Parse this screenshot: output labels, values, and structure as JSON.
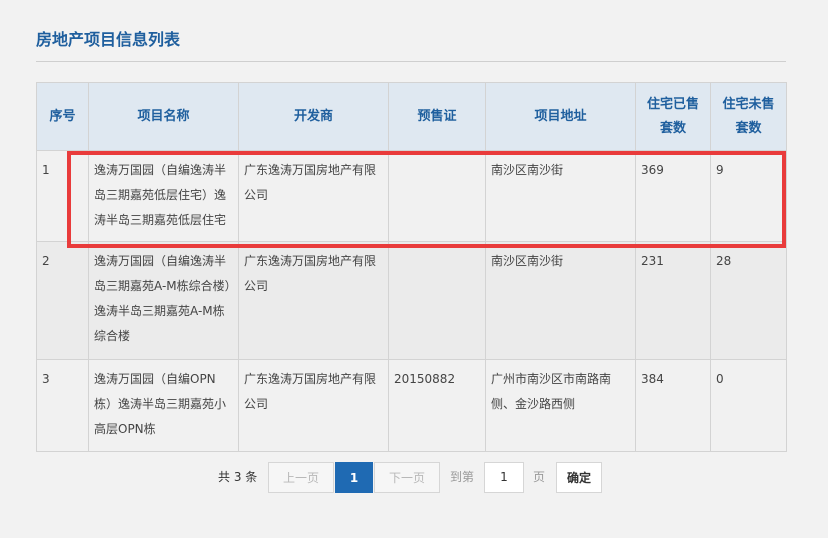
{
  "page": {
    "title": "房地产项目信息列表"
  },
  "table": {
    "headers": [
      "序号",
      "项目名称",
      "开发商",
      "预售证",
      "项目地址",
      "住宅已售套数",
      "住宅未售套数"
    ],
    "rows": [
      [
        "1",
        "逸涛万国园（自编逸涛半岛三期嘉苑低层住宅）逸涛半岛三期嘉苑低层住宅",
        "广东逸涛万国房地产有限公司",
        "",
        "南沙区南沙街",
        "369",
        "9"
      ],
      [
        "2",
        "逸涛万国园（自编逸涛半岛三期嘉苑A-M栋综合楼）逸涛半岛三期嘉苑A-M栋综合楼",
        "广东逸涛万国房地产有限公司",
        "",
        "南沙区南沙街",
        "231",
        "28"
      ],
      [
        "3",
        "逸涛万国园（自编OPN栋）逸涛半岛三期嘉苑小高层OPN栋",
        "广东逸涛万国房地产有限公司",
        "20150882",
        "广州市南沙区市南路南侧、金沙路西侧",
        "384",
        "0"
      ]
    ]
  },
  "pager": {
    "total": "共 3 条",
    "prev": "上一页",
    "current": "1",
    "next": "下一页",
    "goto_label": "到第",
    "goto_value": "1",
    "page_unit": "页",
    "confirm": "确定"
  },
  "colors": {
    "accent": "#1f5f9e",
    "header_bg": "#dfe8f1",
    "highlight": "#e93b3b",
    "current_page": "#1f6ab3"
  }
}
